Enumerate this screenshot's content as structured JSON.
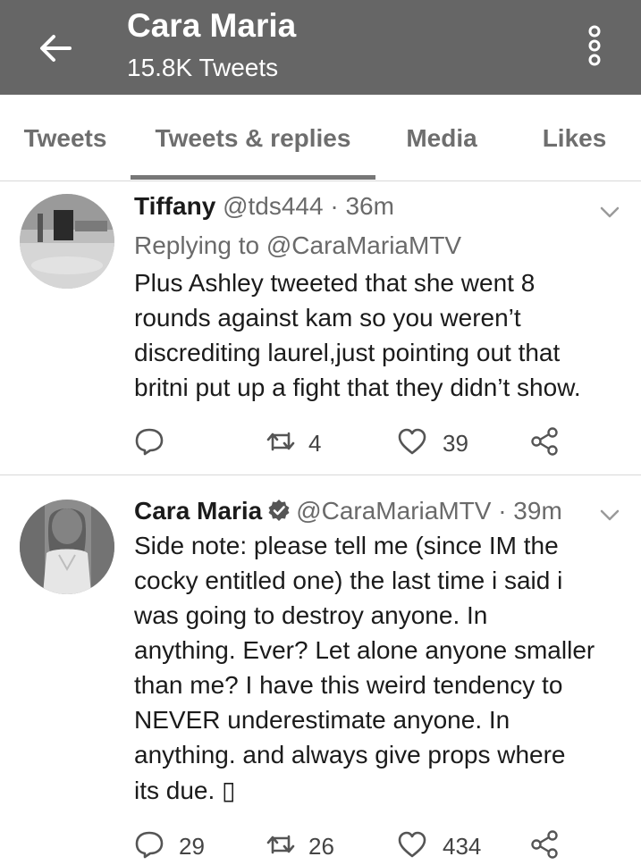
{
  "header": {
    "title": "Cara Maria",
    "subtitle": "15.8K Tweets"
  },
  "tabs": [
    {
      "label": "Tweets"
    },
    {
      "label": "Tweets & replies",
      "active": true
    },
    {
      "label": "Media"
    },
    {
      "label": "Likes"
    }
  ],
  "tweets": [
    {
      "name": "Tiffany",
      "meta": "@tds444 · 36m",
      "reply_to": "Replying to @CaraMariaMTV",
      "lines": [
        "Plus Ashley tweeted that she went 8",
        "rounds against kam so you weren’t",
        "discrediting laurel,just pointing out that",
        "britni put up a fight that they didn’t show."
      ],
      "replies": "",
      "retweets": "4",
      "likes": "39"
    },
    {
      "name": "Cara Maria",
      "verified": true,
      "meta": "@CaraMariaMTV · 39m",
      "lines": [
        "Side note: please tell me (since IM the",
        "cocky entitled one) the last time i said i",
        "was going to destroy anyone. In",
        "anything. Ever? Let alone anyone smaller",
        "than me? I have this weird tendency to",
        "NEVER underestimate anyone. In",
        "anything. and always give props where",
        "its due. ▯"
      ],
      "replies": "29",
      "retweets": "26",
      "likes": "434"
    }
  ],
  "icons": {
    "back": "arrow-left-icon",
    "more": "more-vertical-icon",
    "caret": "chevron-down-icon",
    "reply": "reply-icon",
    "retweet": "retweet-icon",
    "like": "heart-icon",
    "share": "share-icon",
    "verified": "verified-badge-icon"
  },
  "colors": {
    "topbar": "#666666",
    "tab_active_underline": "#777777"
  }
}
